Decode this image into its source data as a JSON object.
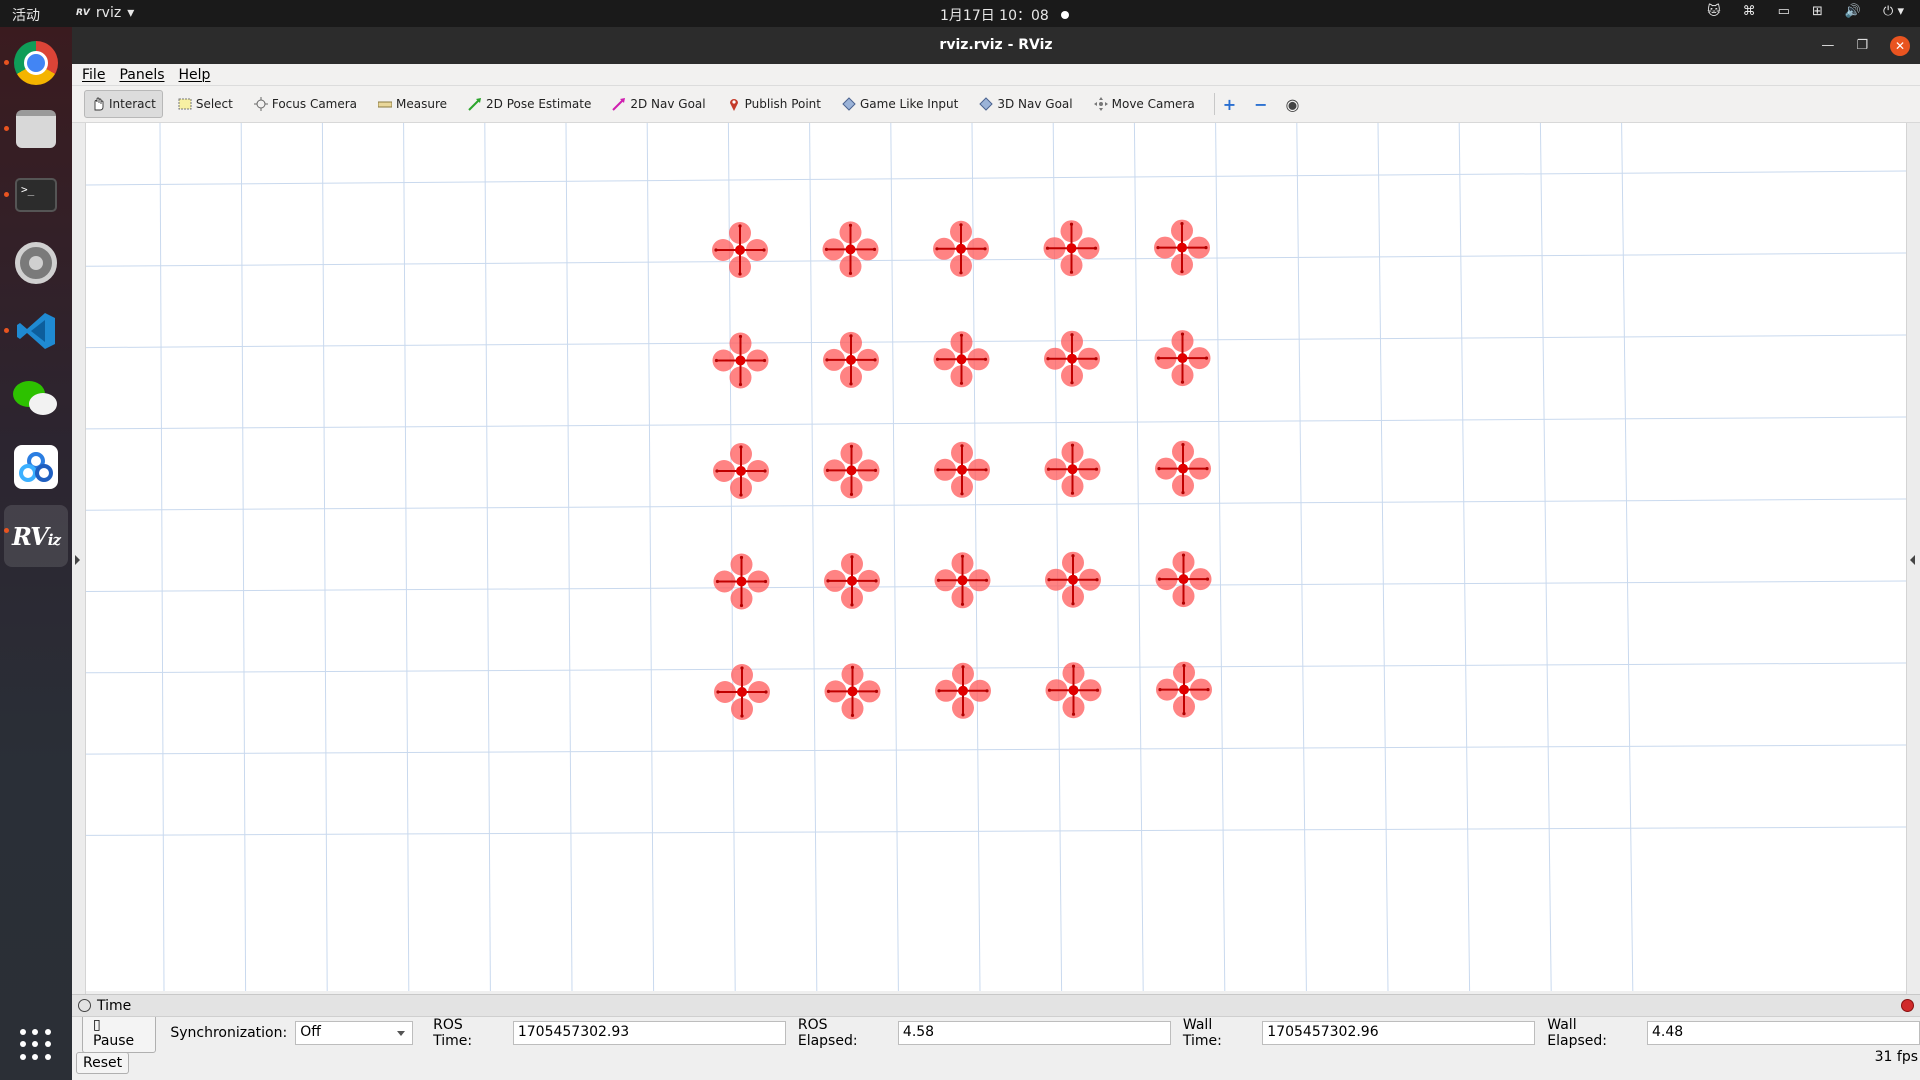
{
  "topbar": {
    "activities": "活动",
    "app_name": "rviz",
    "clock": "1月17日 10：08"
  },
  "window": {
    "title": "rviz.rviz - RViz"
  },
  "menu": {
    "file": "File",
    "panels": "Panels",
    "help": "Help"
  },
  "toolbar": {
    "tools": [
      {
        "label": "Interact",
        "icon": "hand-icon"
      },
      {
        "label": "Select",
        "icon": "select-icon"
      },
      {
        "label": "Focus Camera",
        "icon": "focus-camera-icon"
      },
      {
        "label": "Measure",
        "icon": "ruler-icon"
      },
      {
        "label": "2D Pose Estimate",
        "icon": "green-arrow-icon"
      },
      {
        "label": "2D Nav Goal",
        "icon": "pink-arrow-icon"
      },
      {
        "label": "Publish Point",
        "icon": "map-pin-icon"
      },
      {
        "label": "Game Like Input",
        "icon": "diamond-icon"
      },
      {
        "label": "3D Nav Goal",
        "icon": "diamond-icon"
      },
      {
        "label": "Move Camera",
        "icon": "move-camera-icon"
      }
    ]
  },
  "time_panel": {
    "title": "Time",
    "pause_label": "Pause",
    "sync_label": "Synchronization:",
    "sync_value": "Off",
    "ros_time_label": "ROS Time:",
    "ros_time": "1705457302.93",
    "ros_elapsed_label": "ROS Elapsed:",
    "ros_elapsed": "4.58",
    "wall_time_label": "Wall Time:",
    "wall_time": "1705457302.96",
    "wall_elapsed_label": "Wall Elapsed:",
    "wall_elapsed": "4.48",
    "reset_label": "Reset",
    "fps": "31 fps"
  },
  "scene": {
    "drone_rows": 5,
    "drone_cols": 5,
    "drone_color": "#ff5a5a",
    "grid_color": "#c9d9ee"
  }
}
